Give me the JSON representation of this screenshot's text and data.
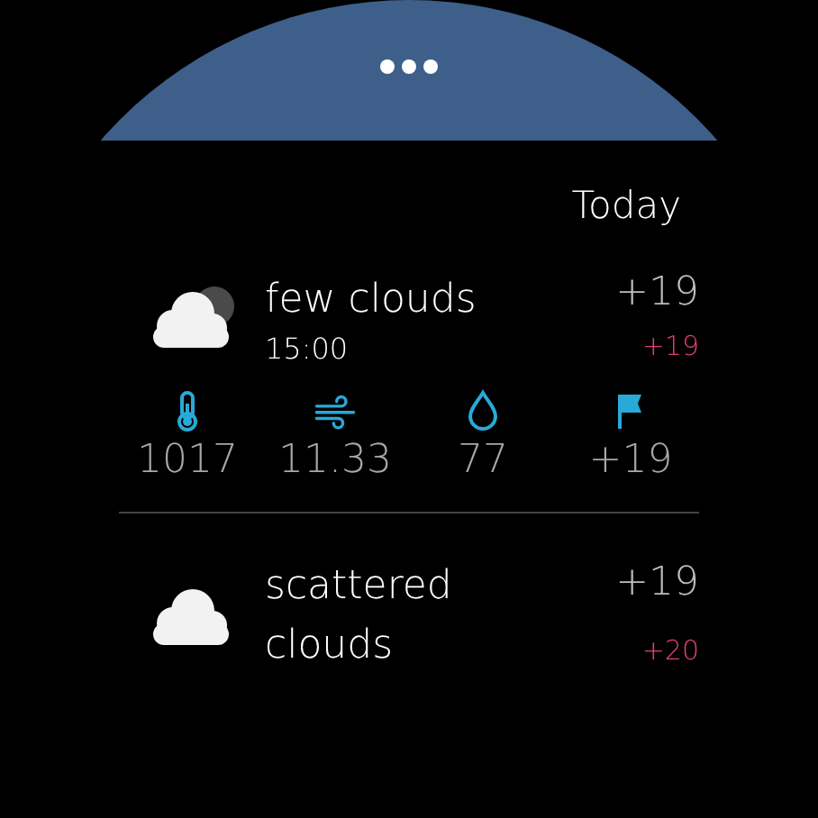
{
  "header": {
    "title": "Today"
  },
  "forecasts": [
    {
      "kind": "partly_cloudy",
      "condition": "few clouds",
      "time": "15:00",
      "temp": "+19",
      "feels": "+19",
      "stats": [
        {
          "kind": "pressure",
          "value": "1017"
        },
        {
          "kind": "wind",
          "value": "11.33"
        },
        {
          "kind": "humidity",
          "value": "77"
        },
        {
          "kind": "flag",
          "value": "+19"
        }
      ]
    },
    {
      "kind": "cloudy",
      "condition": "scattered clouds",
      "temp": "+19",
      "feels": "+20"
    }
  ]
}
